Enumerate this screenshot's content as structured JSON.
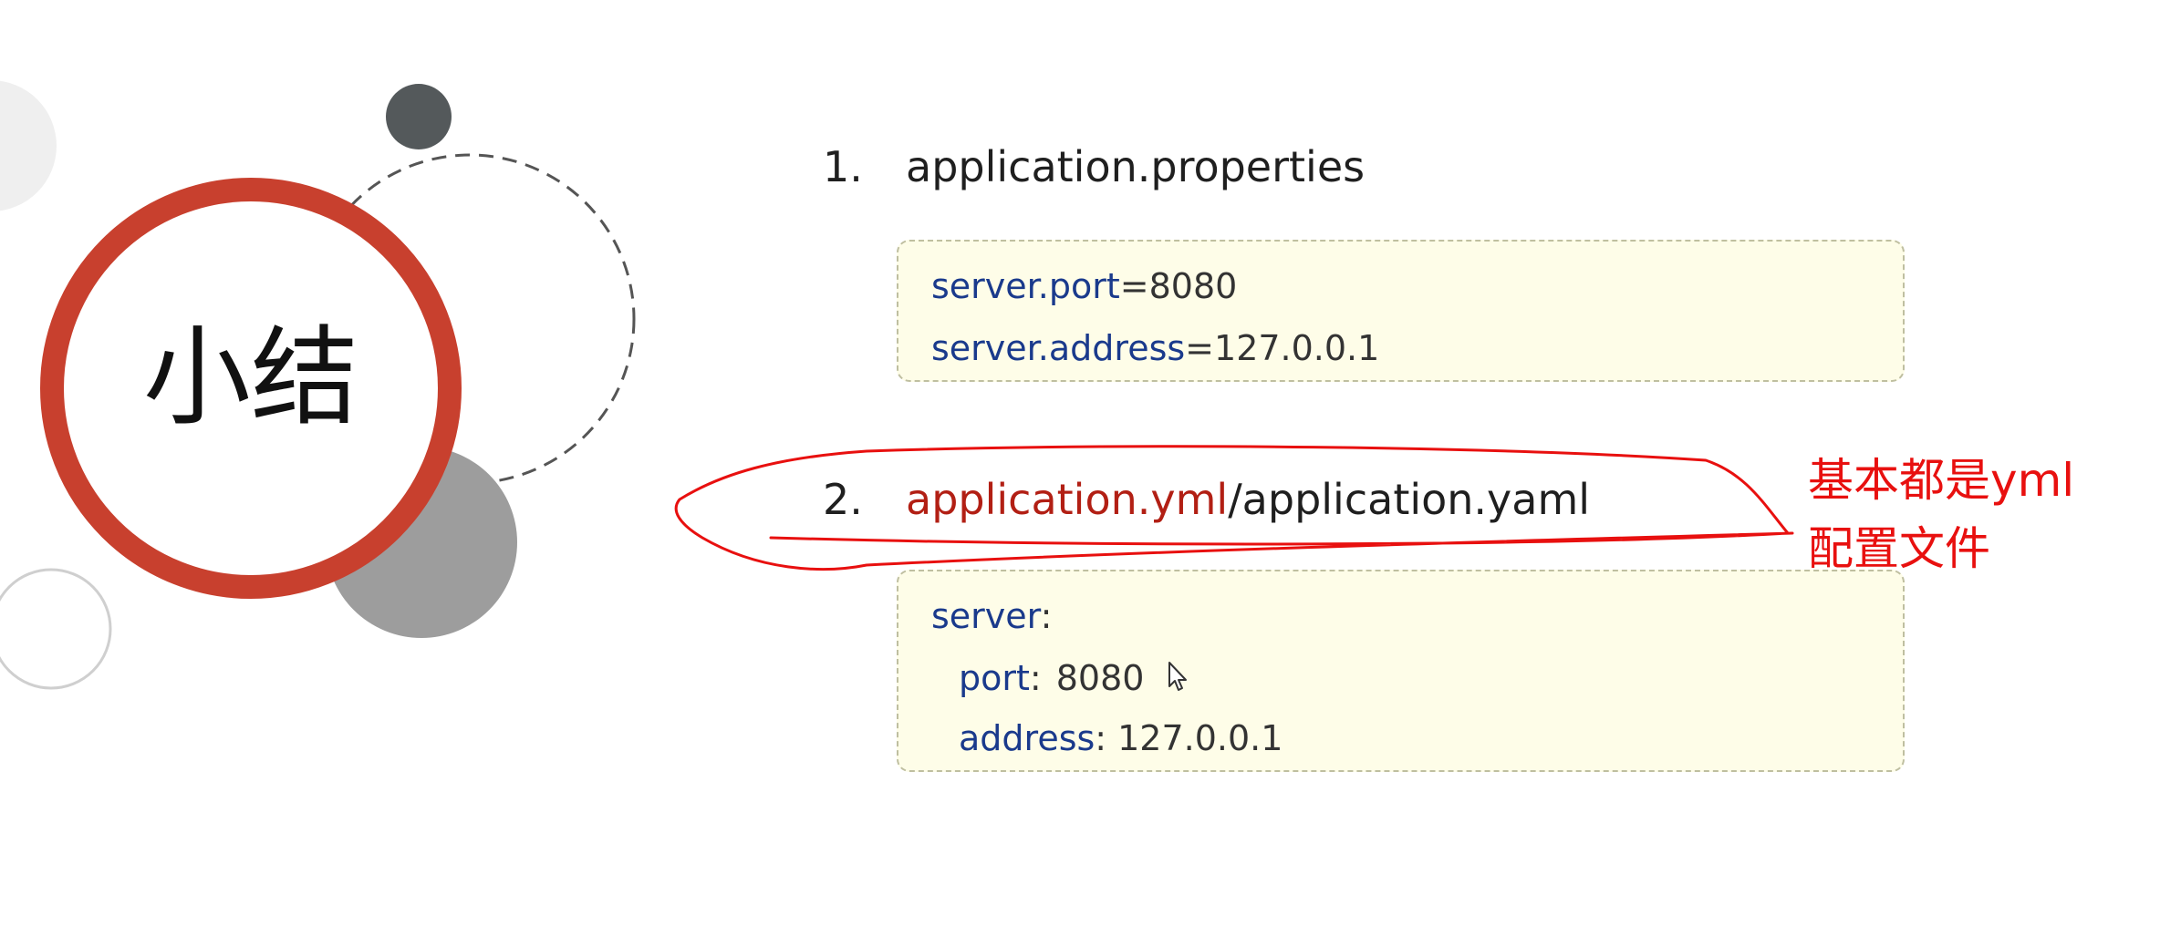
{
  "slide": {
    "title": "小结",
    "items": [
      {
        "number": "1.",
        "text": "application.properties"
      },
      {
        "number": "2.",
        "highlight": "application.yml",
        "rest": "/application.yaml"
      }
    ]
  },
  "properties_code": {
    "line1": {
      "key": "server.port",
      "sep": "=",
      "value": "8080"
    },
    "line2": {
      "key": "server.address",
      "sep": "=",
      "value": "127.0.0.1"
    }
  },
  "yaml_code": {
    "line1": {
      "key": "server",
      "sep": ":"
    },
    "line2": {
      "key": "port",
      "sep": ":",
      "value": "8080"
    },
    "line3": {
      "key": "address",
      "sep": ":",
      "value": "127.0.0.1"
    }
  },
  "annotation": {
    "line1": "基本都是yml",
    "line2": "配置文件",
    "color": "#e8100f"
  },
  "colors": {
    "ring": "#c8402e",
    "key_blue": "#1a3a8c",
    "code_bg": "#fefde8",
    "highlight_red": "#b21f14"
  },
  "icons": [
    "mouse-cursor-icon"
  ]
}
